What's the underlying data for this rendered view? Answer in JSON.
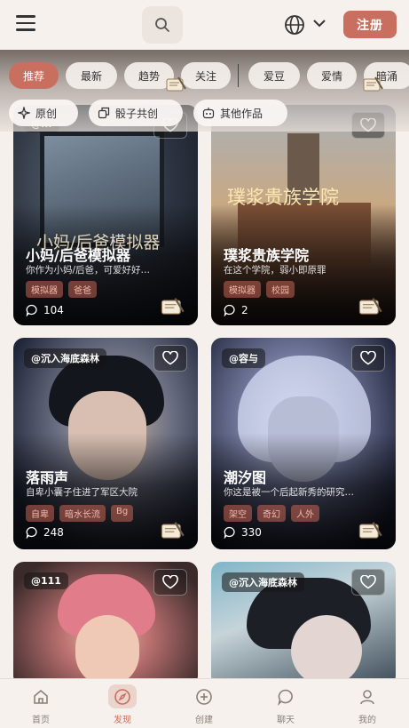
{
  "header": {
    "menu_icon": "hamburger-menu-icon",
    "search_icon": "search-icon",
    "language_icon": "globe-icon",
    "signup_label": "注册"
  },
  "filters": {
    "primary": [
      "推荐",
      "最新",
      "趋势",
      "关注",
      "爱豆",
      "爱情",
      "暗涌"
    ],
    "active": "推荐",
    "secondary": [
      {
        "label": "原创",
        "icon": "sparkle-icon"
      },
      {
        "label": "骰子共创",
        "icon": "dice-share-icon"
      },
      {
        "label": "其他作品",
        "icon": "robot-icon"
      }
    ]
  },
  "cards": [
    {
      "author": "@...",
      "title": "小妈/后爸模拟器",
      "art_text": "小妈/后爸模拟器",
      "desc": "你作为小妈/后爸，可爱好好…",
      "tags": [
        "模拟器",
        "爸爸"
      ],
      "comments": "104"
    },
    {
      "author": "",
      "title": "璞浆贵族学院",
      "art_text": "璞浆贵族学院",
      "desc": "在这个学院，弱小即原罪",
      "tags": [
        "模拟器",
        "校园"
      ],
      "comments": "2"
    },
    {
      "author": "@沉入海底森林",
      "title": "落雨声",
      "art_text": "",
      "desc": "自卑小囊子住进了军区大院",
      "tags": [
        "自卑",
        "暗水长流",
        "Bg"
      ],
      "comments": "248"
    },
    {
      "author": "@容与",
      "title": "潮汐图",
      "art_text": "",
      "desc": "你这是被一个后起新秀的研究…",
      "tags": [
        "架空",
        "奇幻",
        "人外"
      ],
      "comments": "330"
    },
    {
      "author": "@111",
      "title": "",
      "art_text": "",
      "desc": "",
      "tags": [],
      "comments": ""
    },
    {
      "author": "@沉入海底森林",
      "title": "",
      "art_text": "",
      "desc": "",
      "tags": [],
      "comments": ""
    }
  ],
  "nav": {
    "items": [
      {
        "label": "首页",
        "icon": "home-icon"
      },
      {
        "label": "发现",
        "icon": "compass-icon"
      },
      {
        "label": "创建",
        "icon": "plus-circle-icon"
      },
      {
        "label": "聊天",
        "icon": "chat-bubble-icon"
      },
      {
        "label": "我的",
        "icon": "user-icon"
      }
    ],
    "active": "发现"
  },
  "colors": {
    "accent": "#c96f5f",
    "background": "#f5f0ec"
  }
}
